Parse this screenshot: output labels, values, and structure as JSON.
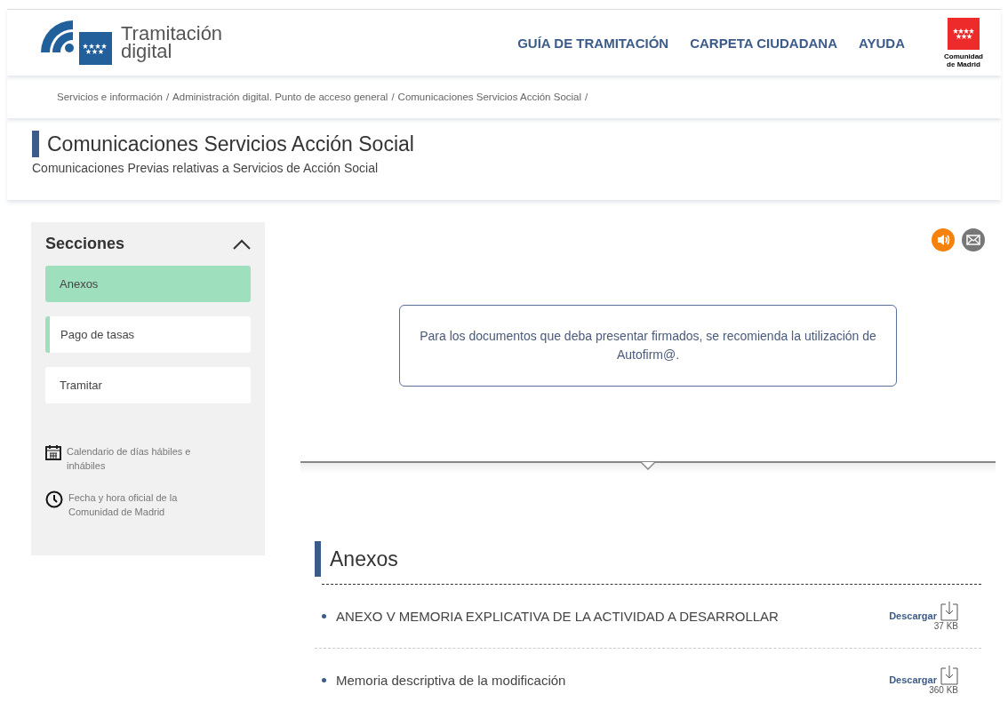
{
  "header": {
    "logo_text": [
      "Tramitación",
      "digital"
    ],
    "nav": [
      "GUÍA DE TRAMITACIÓN",
      "CARPETA CIUDADANA",
      "AYUDA"
    ],
    "region_logo_text": [
      "Comunidad",
      "de Madrid"
    ]
  },
  "breadcrumb": [
    "Servicios e información",
    "Administración digital. Punto de acceso general",
    "Comunicaciones Servicios Acción Social"
  ],
  "breadcrumb_separator": "/",
  "page_title": "Comunicaciones Servicios Acción Social",
  "page_subtitle": "Comunicaciones Previas relativas a Servicios de Acción Social",
  "sidebar": {
    "title": "Secciones",
    "expanded": true,
    "items": [
      {
        "label": "Anexos",
        "selected": true,
        "marked": false
      },
      {
        "label": "Pago de tasas",
        "selected": false,
        "marked": true
      },
      {
        "label": "Tramitar",
        "selected": false,
        "marked": false
      }
    ],
    "links": [
      {
        "kind": "calendar",
        "label": "Calendario de días hábiles e inhábiles"
      },
      {
        "kind": "clock",
        "label": "Fecha y hora oficial de la Comunidad de Madrid"
      }
    ]
  },
  "notice": "Para los documentos que deba presentar firmados, se recomienda la utilización de Autofirm@.",
  "annexes": {
    "title": "Anexos",
    "items": [
      {
        "name": "ANEXO V MEMORIA EXPLICATIVA DE LA ACTIVIDAD A DESARROLLAR",
        "action": "Descargar",
        "size": "37 KB"
      },
      {
        "name": "Memoria descriptiva de la modificación",
        "action": "Descargar",
        "size": "360 KB"
      }
    ]
  }
}
